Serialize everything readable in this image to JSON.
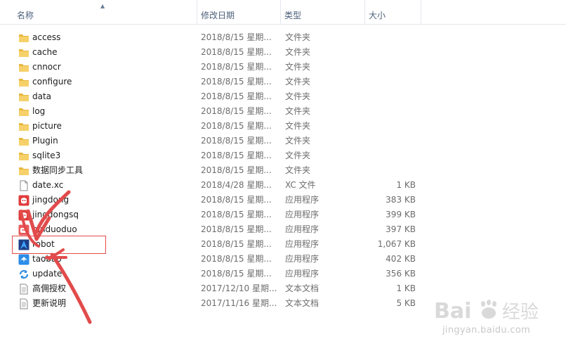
{
  "columns": {
    "name": "名称",
    "modified": "修改日期",
    "type": "类型",
    "size": "大小"
  },
  "rows": [
    {
      "name": "access",
      "modified": "2018/8/15 星期...",
      "type": "文件夹",
      "size": "",
      "icon": "folder-icon"
    },
    {
      "name": "cache",
      "modified": "2018/8/15 星期...",
      "type": "文件夹",
      "size": "",
      "icon": "folder-icon"
    },
    {
      "name": "cnnocr",
      "modified": "2018/8/15 星期...",
      "type": "文件夹",
      "size": "",
      "icon": "folder-icon"
    },
    {
      "name": "configure",
      "modified": "2018/8/15 星期...",
      "type": "文件夹",
      "size": "",
      "icon": "folder-icon"
    },
    {
      "name": "data",
      "modified": "2018/8/15 星期...",
      "type": "文件夹",
      "size": "",
      "icon": "folder-icon"
    },
    {
      "name": "log",
      "modified": "2018/8/15 星期...",
      "type": "文件夹",
      "size": "",
      "icon": "folder-icon"
    },
    {
      "name": "picture",
      "modified": "2018/8/15 星期...",
      "type": "文件夹",
      "size": "",
      "icon": "folder-icon"
    },
    {
      "name": "Plugin",
      "modified": "2018/8/15 星期...",
      "type": "文件夹",
      "size": "",
      "icon": "folder-icon"
    },
    {
      "name": "sqlite3",
      "modified": "2018/8/15 星期...",
      "type": "文件夹",
      "size": "",
      "icon": "folder-icon"
    },
    {
      "name": "数据同步工具",
      "modified": "2018/8/15 星期...",
      "type": "文件夹",
      "size": "",
      "icon": "folder-icon"
    },
    {
      "name": "date.xc",
      "modified": "2018/4/28 星期...",
      "type": "XC 文件",
      "size": "1 KB",
      "icon": "file-icon"
    },
    {
      "name": "jingdong",
      "modified": "2018/8/15 星期...",
      "type": "应用程序",
      "size": "383 KB",
      "icon": "jd-app-icon"
    },
    {
      "name": "jingdongsq",
      "modified": "2018/8/15 星期...",
      "type": "应用程序",
      "size": "399 KB",
      "icon": "jd-app-icon"
    },
    {
      "name": "pinduoduo",
      "modified": "2018/8/15 星期...",
      "type": "应用程序",
      "size": "397 KB",
      "icon": "pdd-app-icon"
    },
    {
      "name": "robot",
      "modified": "2018/8/15 星期...",
      "type": "应用程序",
      "size": "1,067 KB",
      "icon": "robot-app-icon"
    },
    {
      "name": "taobao",
      "modified": "2018/8/15 星期...",
      "type": "应用程序",
      "size": "402 KB",
      "icon": "taobao-app-icon"
    },
    {
      "name": "update",
      "modified": "2018/8/15 星期...",
      "type": "应用程序",
      "size": "356 KB",
      "icon": "update-app-icon"
    },
    {
      "name": "高佣授权",
      "modified": "2017/12/10 星期...",
      "type": "文本文档",
      "size": "1 KB",
      "icon": "text-file-icon"
    },
    {
      "name": "更新说明",
      "modified": "2017/11/16 星期...",
      "type": "文本文档",
      "size": "5 KB",
      "icon": "text-file-icon"
    }
  ],
  "watermark": {
    "brand": "Baidu经验",
    "url": "jingyan.baidu.com"
  },
  "colors": {
    "annotation": "#e24b4b",
    "folder": "#f0c44c"
  }
}
